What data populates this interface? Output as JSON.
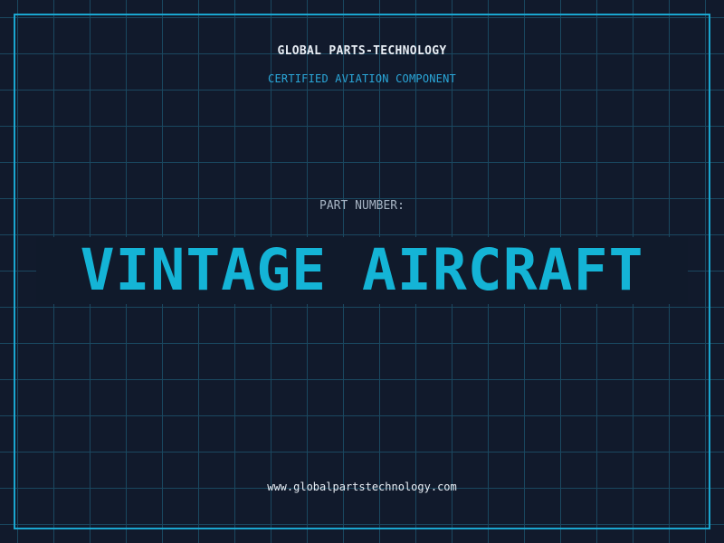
{
  "header": {
    "brand": "GLOBAL PARTS-TECHNOLOGY",
    "tagline": "CERTIFIED AVIATION COMPONENT"
  },
  "main": {
    "part_label": "PART NUMBER:",
    "part_name": "VINTAGE AIRCRAFT"
  },
  "footer": {
    "website": "www.globalpartstechnology.com"
  },
  "colors": {
    "background": "#111a2c",
    "grid": "#1b4b63",
    "accent": "#14b4d6",
    "frame": "#1aa6cf",
    "text": "#e8eef5"
  }
}
